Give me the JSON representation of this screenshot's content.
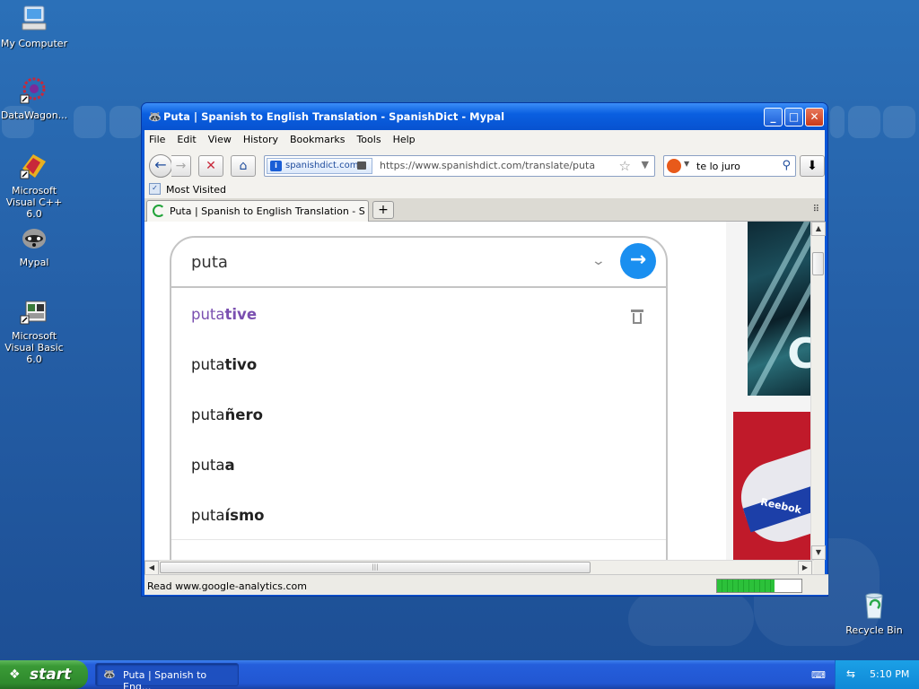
{
  "desktop": {
    "icons": [
      {
        "label": "My Computer"
      },
      {
        "label": "DataWagon..."
      },
      {
        "label": "Microsoft Visual C++ 6.0"
      },
      {
        "label": "Mypal"
      },
      {
        "label": "Microsoft Visual Basic 6.0"
      },
      {
        "label": "Recycle Bin"
      }
    ]
  },
  "window": {
    "title": "Puta | Spanish to English Translation - SpanishDict - Mypal",
    "controls": {
      "minimize": "_",
      "maximize": "□",
      "close": "✕"
    }
  },
  "menu": [
    "File",
    "Edit",
    "View",
    "History",
    "Bookmarks",
    "Tools",
    "Help"
  ],
  "nav": {
    "back": "←",
    "forward": "→",
    "stop": "✕",
    "home": "⌂",
    "identity_domain": "spanishdict.com",
    "url": "https://www.spanishdict.com/translate/puta",
    "search_value": "te lo juro",
    "download": "⬇"
  },
  "bookmarks": {
    "most_visited": "Most Visited"
  },
  "tabs": [
    {
      "label": "Puta | Spanish to English Translation - Spanis..."
    }
  ],
  "page": {
    "query": "puta",
    "suggestions": [
      {
        "prefix": "puta",
        "rest": "tive"
      },
      {
        "prefix": "puta",
        "rest": "tivo"
      },
      {
        "prefix": "puta",
        "rest": "ñero"
      },
      {
        "prefix": "puta",
        "rest": "a"
      },
      {
        "prefix": "puta",
        "rest": "ísmo"
      }
    ],
    "ad_text": "Reebok"
  },
  "status": {
    "text": "Read www.google-analytics.com",
    "progress": 0.68
  },
  "taskbar": {
    "start": "start",
    "task": "Puta | Spanish to Eng...",
    "clock": "5:10 PM"
  },
  "colors": {
    "accent": "#1a8ff0",
    "visited_suggestion": "#7a4fb0",
    "titlebar": "#0752d0",
    "start_green": "#3a9a36"
  }
}
